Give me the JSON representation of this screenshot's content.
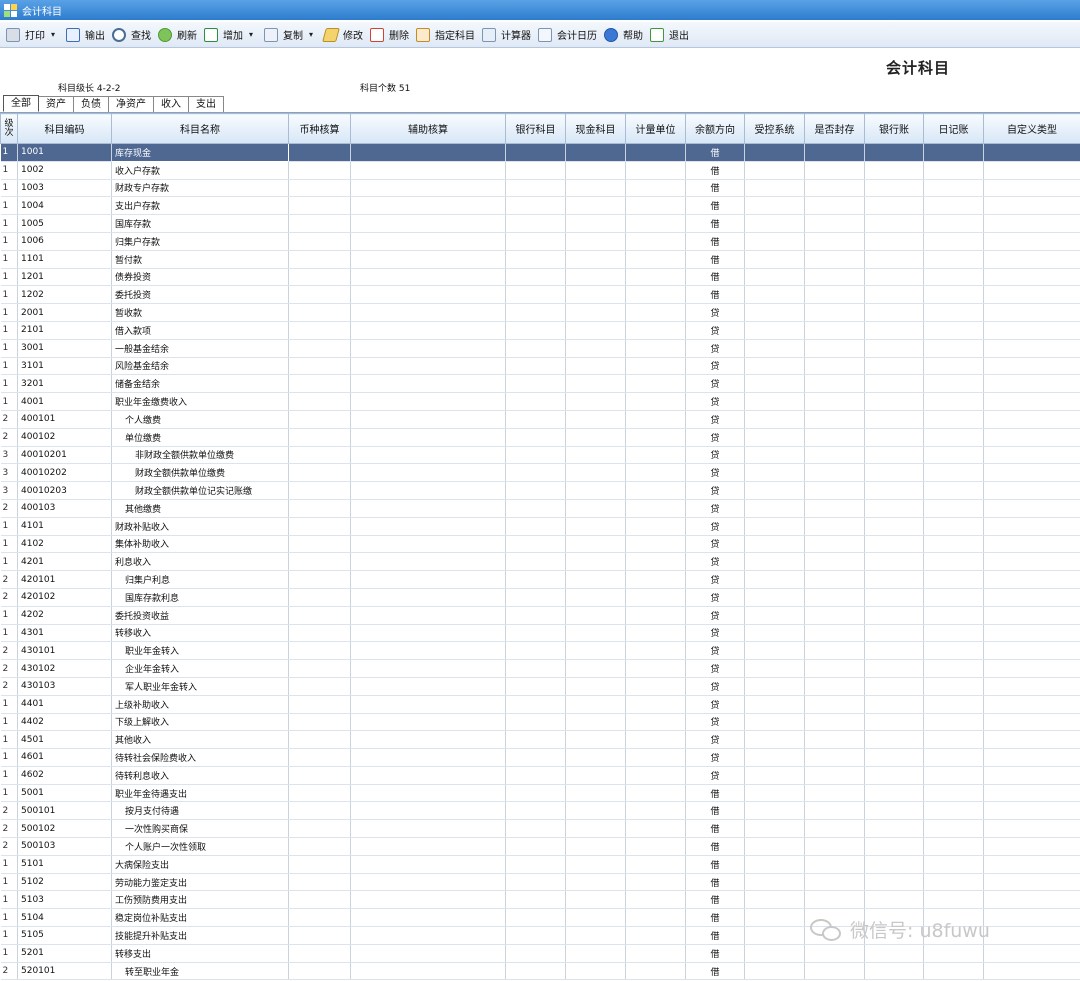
{
  "window": {
    "title": "会计科目"
  },
  "toolbar": [
    {
      "label": "打印",
      "icon": "print-icon",
      "dropdown": true
    },
    {
      "label": "输出",
      "icon": "export-icon",
      "dropdown": false
    },
    {
      "label": "查找",
      "icon": "search-icon",
      "dropdown": false
    },
    {
      "label": "刷新",
      "icon": "refresh-icon",
      "dropdown": false
    },
    {
      "label": "增加",
      "icon": "add-icon",
      "dropdown": true
    },
    {
      "label": "复制",
      "icon": "copy-icon",
      "dropdown": true
    },
    {
      "label": "修改",
      "icon": "edit-icon",
      "dropdown": false
    },
    {
      "label": "删除",
      "icon": "delete-icon",
      "dropdown": false
    },
    {
      "label": "指定科目",
      "icon": "assign-subject-icon",
      "dropdown": false
    },
    {
      "label": "计算器",
      "icon": "calculator-icon",
      "dropdown": false
    },
    {
      "label": "会计日历",
      "icon": "calendar-icon",
      "dropdown": false
    },
    {
      "label": "帮助",
      "icon": "help-icon",
      "dropdown": false
    },
    {
      "label": "退出",
      "icon": "exit-icon",
      "dropdown": false
    }
  ],
  "header": {
    "title": "会计科目",
    "level_length": "科目级长 4-2-2",
    "count": "科目个数 51"
  },
  "tabs": [
    {
      "label": "全部",
      "active": true
    },
    {
      "label": "资产",
      "active": false
    },
    {
      "label": "负债",
      "active": false
    },
    {
      "label": "净资产",
      "active": false
    },
    {
      "label": "收入",
      "active": false
    },
    {
      "label": "支出",
      "active": false
    }
  ],
  "columns": [
    "级次",
    "科目编码",
    "科目名称",
    "币种核算",
    "辅助核算",
    "银行科目",
    "现金科目",
    "计量单位",
    "余额方向",
    "受控系统",
    "是否封存",
    "银行账",
    "日记账",
    "自定义类型"
  ],
  "rows": [
    {
      "level": "1",
      "code": "1001",
      "name": "库存现金",
      "dir": "借"
    },
    {
      "level": "1",
      "code": "1002",
      "name": "收入户存款",
      "dir": "借"
    },
    {
      "level": "1",
      "code": "1003",
      "name": "财政专户存款",
      "dir": "借"
    },
    {
      "level": "1",
      "code": "1004",
      "name": "支出户存款",
      "dir": "借"
    },
    {
      "level": "1",
      "code": "1005",
      "name": "国库存款",
      "dir": "借"
    },
    {
      "level": "1",
      "code": "1006",
      "name": "归集户存款",
      "dir": "借"
    },
    {
      "level": "1",
      "code": "1101",
      "name": "暂付款",
      "dir": "借"
    },
    {
      "level": "1",
      "code": "1201",
      "name": "债券投资",
      "dir": "借"
    },
    {
      "level": "1",
      "code": "1202",
      "name": "委托投资",
      "dir": "借"
    },
    {
      "level": "1",
      "code": "2001",
      "name": "暂收款",
      "dir": "贷"
    },
    {
      "level": "1",
      "code": "2101",
      "name": "借入款项",
      "dir": "贷"
    },
    {
      "level": "1",
      "code": "3001",
      "name": "一般基金结余",
      "dir": "贷"
    },
    {
      "level": "1",
      "code": "3101",
      "name": "风险基金结余",
      "dir": "贷"
    },
    {
      "level": "1",
      "code": "3201",
      "name": "储备金结余",
      "dir": "贷"
    },
    {
      "level": "1",
      "code": "4001",
      "name": "职业年金缴费收入",
      "dir": "贷"
    },
    {
      "level": "2",
      "code": "400101",
      "name": "个人缴费",
      "dir": "贷"
    },
    {
      "level": "2",
      "code": "400102",
      "name": "单位缴费",
      "dir": "贷"
    },
    {
      "level": "3",
      "code": "40010201",
      "name": "非财政全额供款单位缴费",
      "dir": "贷"
    },
    {
      "level": "3",
      "code": "40010202",
      "name": "财政全额供款单位缴费",
      "dir": "贷"
    },
    {
      "level": "3",
      "code": "40010203",
      "name": "财政全额供款单位记实记账缴",
      "dir": "贷"
    },
    {
      "level": "2",
      "code": "400103",
      "name": "其他缴费",
      "dir": "贷"
    },
    {
      "level": "1",
      "code": "4101",
      "name": "财政补贴收入",
      "dir": "贷"
    },
    {
      "level": "1",
      "code": "4102",
      "name": "集体补助收入",
      "dir": "贷"
    },
    {
      "level": "1",
      "code": "4201",
      "name": "利息收入",
      "dir": "贷"
    },
    {
      "level": "2",
      "code": "420101",
      "name": "归集户利息",
      "dir": "贷"
    },
    {
      "level": "2",
      "code": "420102",
      "name": "国库存款利息",
      "dir": "贷"
    },
    {
      "level": "1",
      "code": "4202",
      "name": "委托投资收益",
      "dir": "贷"
    },
    {
      "level": "1",
      "code": "4301",
      "name": "转移收入",
      "dir": "贷"
    },
    {
      "level": "2",
      "code": "430101",
      "name": "职业年金转入",
      "dir": "贷"
    },
    {
      "level": "2",
      "code": "430102",
      "name": "企业年金转入",
      "dir": "贷"
    },
    {
      "level": "2",
      "code": "430103",
      "name": "军人职业年金转入",
      "dir": "贷"
    },
    {
      "level": "1",
      "code": "4401",
      "name": "上级补助收入",
      "dir": "贷"
    },
    {
      "level": "1",
      "code": "4402",
      "name": "下级上解收入",
      "dir": "贷"
    },
    {
      "level": "1",
      "code": "4501",
      "name": "其他收入",
      "dir": "贷"
    },
    {
      "level": "1",
      "code": "4601",
      "name": "待转社会保险费收入",
      "dir": "贷"
    },
    {
      "level": "1",
      "code": "4602",
      "name": "待转利息收入",
      "dir": "贷"
    },
    {
      "level": "1",
      "code": "5001",
      "name": "职业年金待遇支出",
      "dir": "借"
    },
    {
      "level": "2",
      "code": "500101",
      "name": "按月支付待遇",
      "dir": "借"
    },
    {
      "level": "2",
      "code": "500102",
      "name": "一次性购买商保",
      "dir": "借"
    },
    {
      "level": "2",
      "code": "500103",
      "name": "个人账户一次性领取",
      "dir": "借"
    },
    {
      "level": "1",
      "code": "5101",
      "name": "大病保险支出",
      "dir": "借"
    },
    {
      "level": "1",
      "code": "5102",
      "name": "劳动能力鉴定支出",
      "dir": "借"
    },
    {
      "level": "1",
      "code": "5103",
      "name": "工伤预防费用支出",
      "dir": "借"
    },
    {
      "level": "1",
      "code": "5104",
      "name": "稳定岗位补贴支出",
      "dir": "借"
    },
    {
      "level": "1",
      "code": "5105",
      "name": "技能提升补贴支出",
      "dir": "借"
    },
    {
      "level": "1",
      "code": "5201",
      "name": "转移支出",
      "dir": "借"
    },
    {
      "level": "2",
      "code": "520101",
      "name": "转至职业年金",
      "dir": "借"
    }
  ],
  "selected_row_index": 0,
  "watermark": {
    "text": "微信号: u8fuwu",
    "icon": "wechat-icon"
  }
}
